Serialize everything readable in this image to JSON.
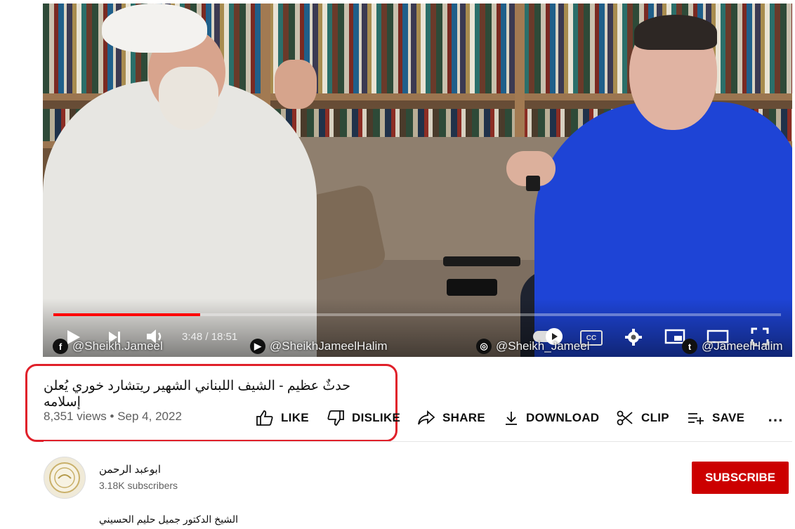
{
  "player": {
    "current_time": "3:48",
    "duration": "18:51",
    "time_text": "3:48 / 18:51",
    "progress_fraction": 0.2016,
    "progress_color": "#ff0000",
    "cc_label": "CC",
    "social": {
      "facebook": "@Sheikh.Jameel",
      "youtube": "@SheikhJameelHalim",
      "instagram": "@Sheikh_Jameel",
      "twitter": "@JameelHalim"
    }
  },
  "video": {
    "title": "حدثٌ عظيم - الشيف اللبناني الشهير ريتشارد خوري يُعلن إسلامه",
    "views": "8,351 views",
    "separator": "•",
    "date": "Sep 4, 2022"
  },
  "actions": {
    "like": "LIKE",
    "dislike": "DISLIKE",
    "share": "SHARE",
    "download": "DOWNLOAD",
    "clip": "CLIP",
    "save": "SAVE",
    "more": "⋯"
  },
  "channel": {
    "name": "ابوعبد الرحمن",
    "subscribers": "3.18K subscribers",
    "subscribe_label": "SUBSCRIBE",
    "subscribe_color": "#cc0000"
  },
  "description": {
    "first_line": "الشيخ الدكتور جميل حليم الحسيني"
  },
  "highlight_color": "#e0202a"
}
